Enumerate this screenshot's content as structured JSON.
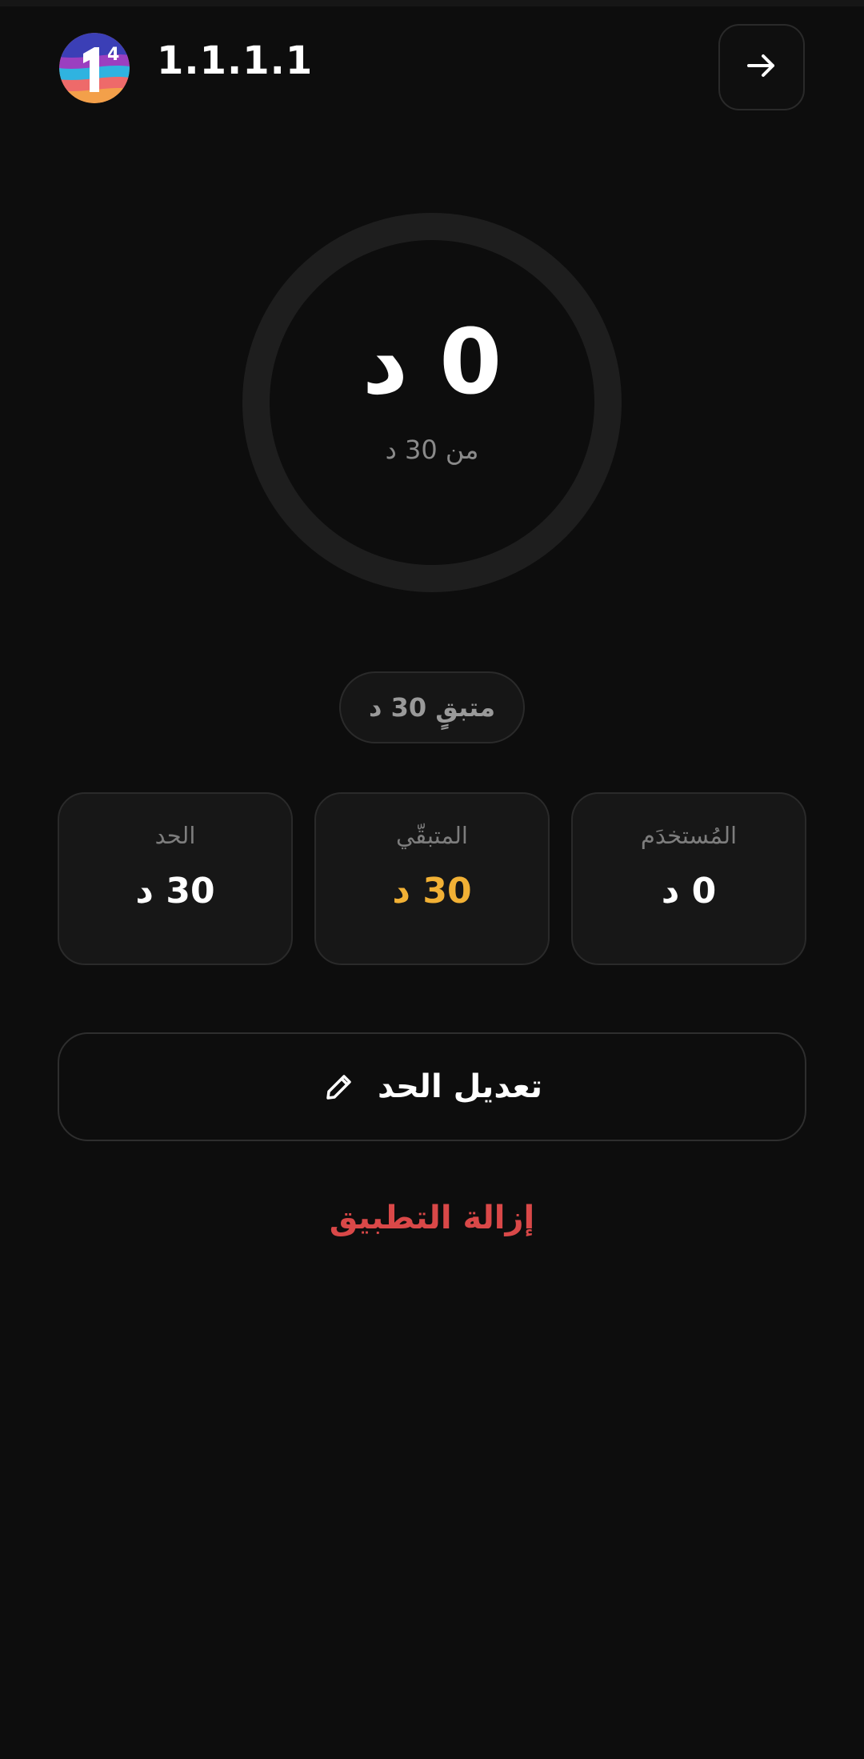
{
  "header": {
    "app_title": "1.1.1.1",
    "app_icon": "app-logo-icon",
    "back_icon": "arrow-right-icon"
  },
  "usage_ring": {
    "value_text": "0 د",
    "subtitle": "من 30 د",
    "used_fraction": 0
  },
  "remaining_pill": {
    "label": "متبقٍ 30 د"
  },
  "stats": {
    "used": {
      "label": "المُستخدَم",
      "value": "0 د"
    },
    "remaining": {
      "label": "المتبقّي",
      "value": "30 د"
    },
    "limit": {
      "label": "الحد",
      "value": "30 د"
    }
  },
  "actions": {
    "edit_limit_label": "تعديل الحد",
    "edit_icon": "pencil-icon",
    "remove_app_label": "إزالة التطبيق"
  },
  "colors": {
    "background": "#0d0d0d",
    "card": "#171717",
    "accent_remaining": "#f2b135",
    "danger": "#d94848",
    "ring_track": "#1e1e1e"
  }
}
